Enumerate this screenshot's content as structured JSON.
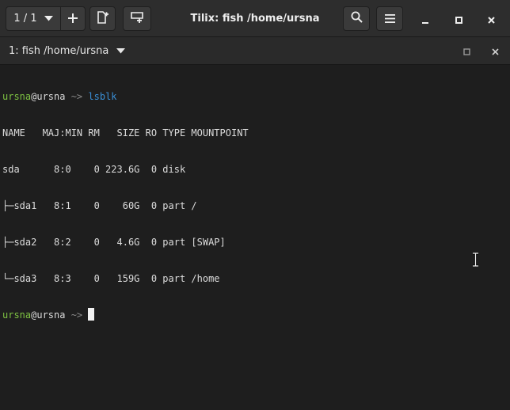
{
  "header": {
    "session_label": "1 / 1",
    "window_title": "Tilix: fish /home/ursna"
  },
  "tab": {
    "title": "1: fish /home/ursna"
  },
  "terminal": {
    "prompt_user": "ursna",
    "prompt_at": "@",
    "prompt_host": "ursna",
    "prompt_path": " ~> ",
    "command": "lsblk",
    "output": [
      "NAME   MAJ:MIN RM   SIZE RO TYPE MOUNTPOINT",
      "sda      8:0    0 223.6G  0 disk ",
      "├─sda1   8:1    0    60G  0 part /",
      "├─sda2   8:2    0   4.6G  0 part [SWAP]",
      "└─sda3   8:3    0   159G  0 part /home"
    ]
  },
  "icons": {
    "session_dropdown": "chevron-down-icon",
    "add_session": "plus-icon",
    "add_terminal_right": "split-right-icon",
    "add_terminal_down": "split-down-icon",
    "find": "search-icon",
    "menu": "hamburger-menu-icon",
    "minimize": "minimize-icon",
    "maximize": "maximize-icon",
    "close": "close-icon"
  },
  "colors": {
    "prompt_user": "#7ec242",
    "command": "#3a8fd6",
    "background": "#1e1e1e",
    "headerbar": "#2d2d2d"
  }
}
